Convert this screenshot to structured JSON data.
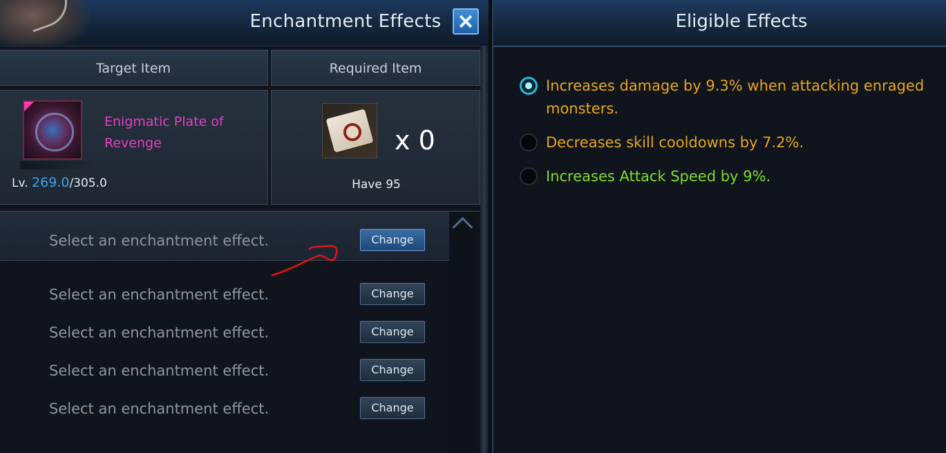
{
  "enchant": {
    "title": "Enchantment Effects",
    "close_label": "close",
    "col_target": "Target Item",
    "col_required": "Required Item",
    "target": {
      "name": "Enigmatic Plate of Revenge",
      "lv_prefix": "Lv.",
      "lv_current": "269.0",
      "lv_max": "/305.0"
    },
    "required": {
      "count": "x 0",
      "have": "Have 95"
    },
    "slots": [
      {
        "label": "Select an enchantment effect.",
        "button": "Change",
        "selected": true
      },
      {
        "label": "Select an enchantment effect.",
        "button": "Change",
        "selected": false
      },
      {
        "label": "Select an enchantment effect.",
        "button": "Change",
        "selected": false
      },
      {
        "label": "Select an enchantment effect.",
        "button": "Change",
        "selected": false
      },
      {
        "label": "Select an enchantment effect.",
        "button": "Change",
        "selected": false
      }
    ]
  },
  "eligible": {
    "title": "Eligible Effects",
    "options": [
      {
        "text": "Increases damage by 9.3% when attacking enraged monsters.",
        "color": "#e6a51e",
        "checked": true
      },
      {
        "text": "Decreases skill cooldowns by 7.2%.",
        "color": "#e6a51e",
        "checked": false
      },
      {
        "text": "Increases Attack Speed by 9%.",
        "color": "#7ddc2a",
        "checked": false
      }
    ]
  },
  "colors": {
    "item_name": "#e53fc4",
    "level_current": "#3aa2f2",
    "accent": "#29b7d9",
    "annotation": "#e01414"
  },
  "icons": {
    "close": "close-icon",
    "target_item": "armor-plate-icon",
    "required_item": "enchant-scroll-icon",
    "scroll_up": "chevron-up-icon"
  }
}
